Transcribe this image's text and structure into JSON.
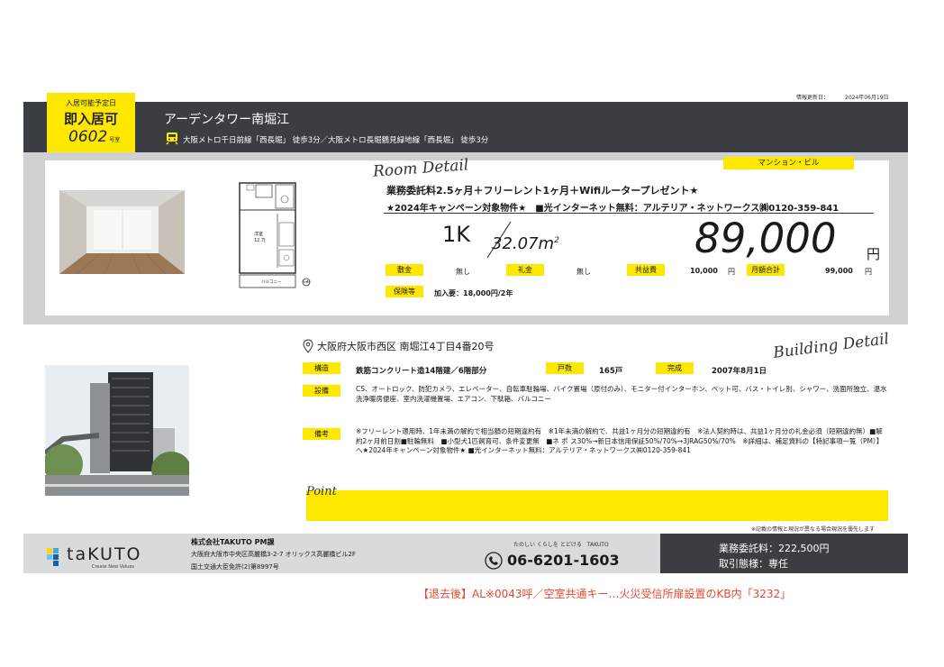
{
  "update": {
    "label": "情報更新日：",
    "value": "2024年06月19日"
  },
  "tag": {
    "line1": "入居可能予定日",
    "line2": "即入居可",
    "room": "0602",
    "room_suffix": "号室"
  },
  "header": {
    "property_name": "アーデンタワー南堀江",
    "station": "大阪メトロ千日前線「西長堀」 徒歩3分／大阪メトロ長堀鶴見緑地線「西長堀」 徒歩3分",
    "train_icon": "train-icon"
  },
  "room": {
    "title": "Room Detail",
    "type": "マンション・ビル",
    "campaign1": "業務委託料2.5ヶ月＋フリーレント1ヶ月＋Wifiルータープレゼント★",
    "campaign2": "★2024年キャンペーン対象物件★　■光インターネット無料：アルテリア・ネットワークス㈱0120-359-841",
    "layout": "1K",
    "area": "32.07",
    "area_unit": "m",
    "area_sup": "2",
    "rent": "89,000",
    "rent_unit": "円",
    "deposit_label": "敷金",
    "deposit": "無し",
    "key_money_label": "礼金",
    "key_money": "無し",
    "common_fee_label": "共益費",
    "common_fee": "10,000",
    "common_fee_unit": "円",
    "monthly_total_label": "月額合計",
    "monthly_total": "99,000",
    "monthly_total_unit": "円",
    "insurance_label": "保険等",
    "insurance": "加入要：18,000円/2年"
  },
  "floorplan": {
    "room_label": "洋室",
    "room_size": "12.7J",
    "balcony": "バルコニー"
  },
  "building": {
    "title": "Building Detail",
    "address": "大阪府大阪市西区 南堀江4丁目4番20号",
    "structure_label": "構造",
    "structure": "鉄筋コンクリート造14階建／6階部分",
    "units_label": "戸数",
    "units": "165戸",
    "completed_label": "完成",
    "completed": "2007年8月1日",
    "facilities_label": "設備",
    "facilities": "CS、オートロック、防犯カメラ、エレベーター、自転車駐輪場、バイク置場（原付のみ）、モニター付インターホン、ペット可、バス・トイレ別、シャワー、洗面所独立、温水洗浄暖房便座、室内洗濯機置場、エアコン、下駄箱、バルコニー",
    "remarks_label": "備考",
    "remarks": "※フリーレント適用時、1年未満の解約で相当額の短期違約有　※1年未満の解約で、共益1ヶ月分の短期違約有　※法人契約時は、共益1ヶ月分の礼金必須（短期違約無）■解約2ヶ月前日割■駐輪無料　■小型犬1匹飼育可、条件変更無　■ネ ポ ス30%→新日本信用保証50%/70%→3JRAG50%/70%　※詳細は、補足資料の【特記事項一覧（PM）】へ★2024年キャンペーン対象物件★ ■光インターネット無料：アルテリア・ネットワークス㈱0120-359-841"
  },
  "point": {
    "title": "Point",
    "text": ""
  },
  "note": "※記載の情報と現況が異なる場合現況を優先します",
  "footer": {
    "logo_text": "taKUTO",
    "logo_sub": "Create New Values",
    "company": "株式会社TAKUTO PM課",
    "address": "大阪府大阪市中央区高麗橋3-2-7 オリックス高麗橋ビル2F",
    "license": "国土交通大臣免許(2)第8997号",
    "tagline": "たのしい くらしを とどける　TAKUTO",
    "phone": "06-6201-1603",
    "fee": "業務委託料：222,500円",
    "mode": "取引態様：専任"
  },
  "footnote": "【退去後】AL※0043呼／空室共通キー…火災受信所扉設置のKB内「3232」",
  "colors": {
    "yellow": "#ffe800",
    "dark": "#3a3e43",
    "gray": "#cfd0d2",
    "note_red": "#e8482e"
  }
}
